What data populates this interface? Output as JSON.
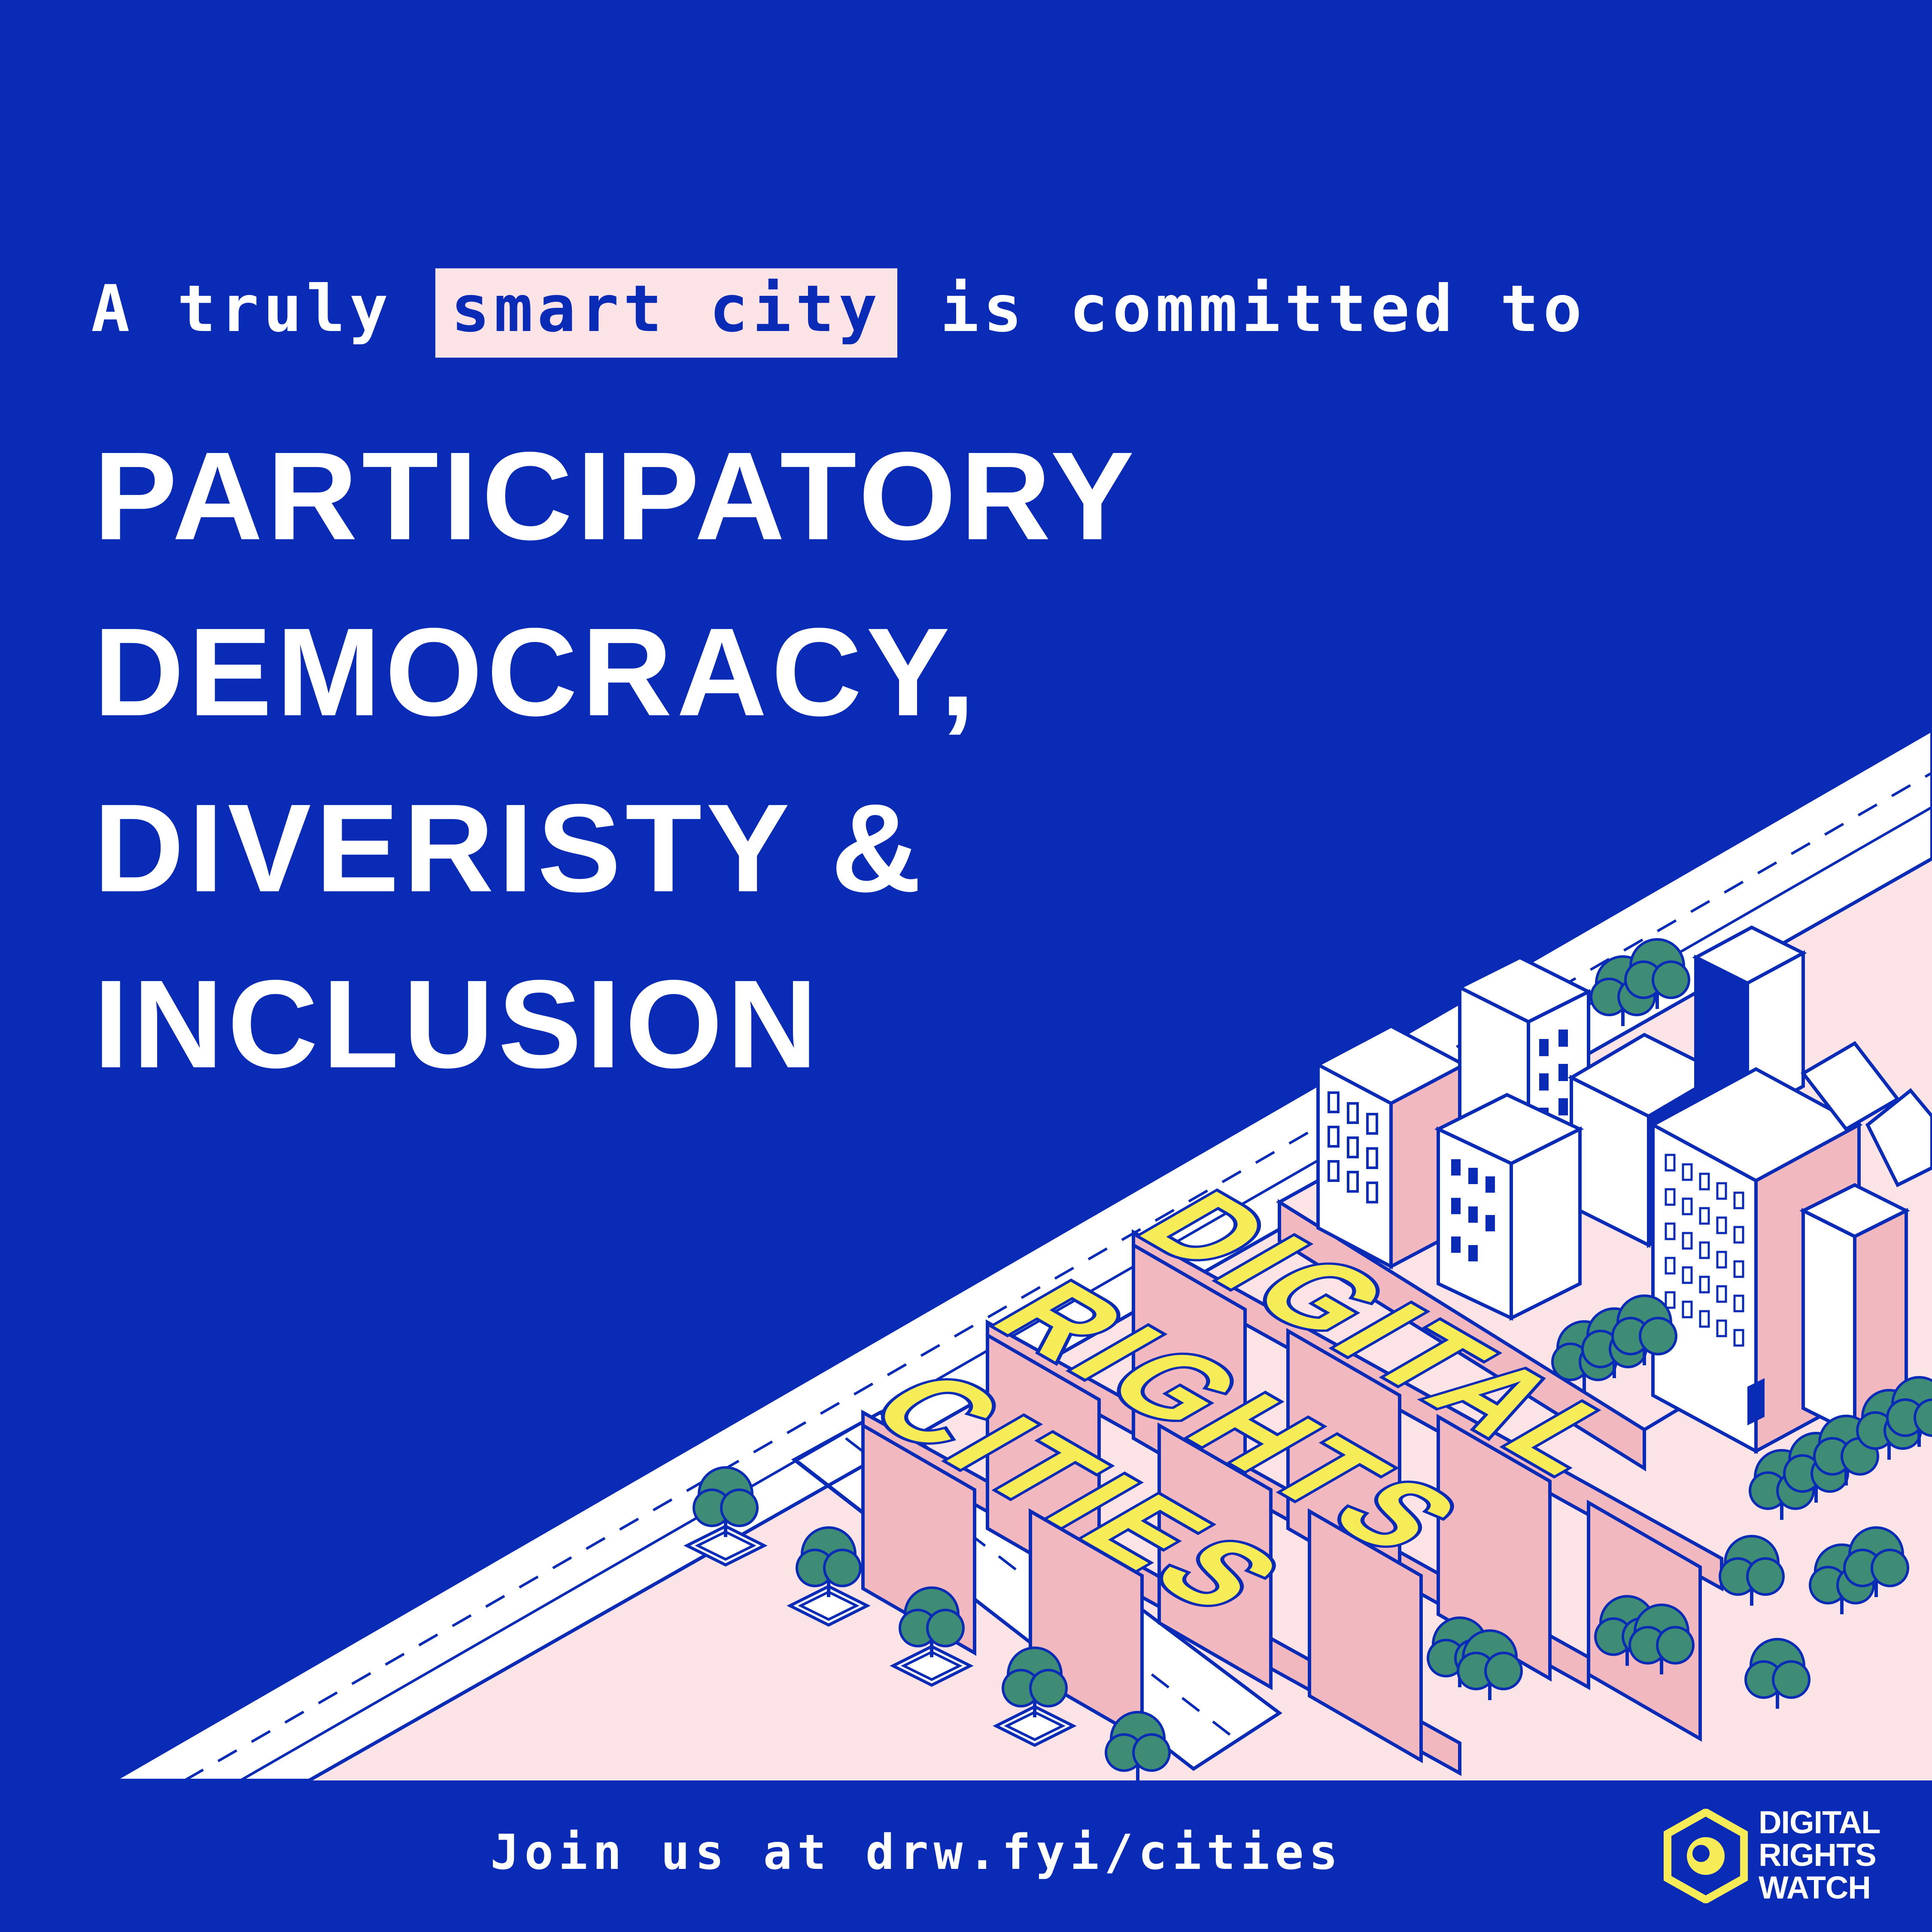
{
  "intro": {
    "before": "A truly",
    "highlight": "smart city",
    "after": "is committed to"
  },
  "headline": {
    "line1": "PARTICIPATORY",
    "line2": "DEMOCRACY,",
    "line3": "DIVERISTY &",
    "line4": "INCLUSION"
  },
  "illustration": {
    "sign_line1": "DIGITAL",
    "sign_line2": "RIGHTS",
    "sign_line3": "CITIES"
  },
  "footer": {
    "cta": "Join us at drw.fyi/cities"
  },
  "logo": {
    "line1": "DIGITAL",
    "line2": "RIGHTS",
    "line3": "WATCH"
  },
  "colors": {
    "background": "#0a2bb5",
    "pink": "#fbe3e6",
    "building_pink": "#f1b8c0",
    "yellow": "#f6ec57",
    "tree": "#3e8c76",
    "white": "#ffffff"
  }
}
